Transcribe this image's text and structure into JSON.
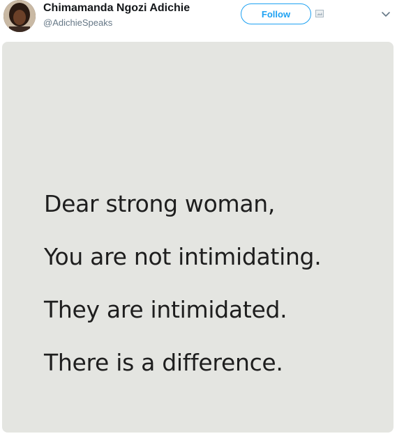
{
  "tweet": {
    "author": {
      "display_name": "Chimamanda Ngozi Adichie",
      "handle": "@AdichieSpeaks",
      "avatar_icon": "profile-photo"
    },
    "follow_label": "Follow",
    "menu_icon": "chevron-down-icon",
    "media": {
      "background_color": "#e4e5e1",
      "lines": [
        "Dear strong woman,",
        "You are not intimidating.",
        "They are intimidated.",
        "There is a difference."
      ]
    }
  },
  "colors": {
    "accent": "#1da1f2",
    "handle_gray": "#657786",
    "name_black": "#14171a"
  }
}
